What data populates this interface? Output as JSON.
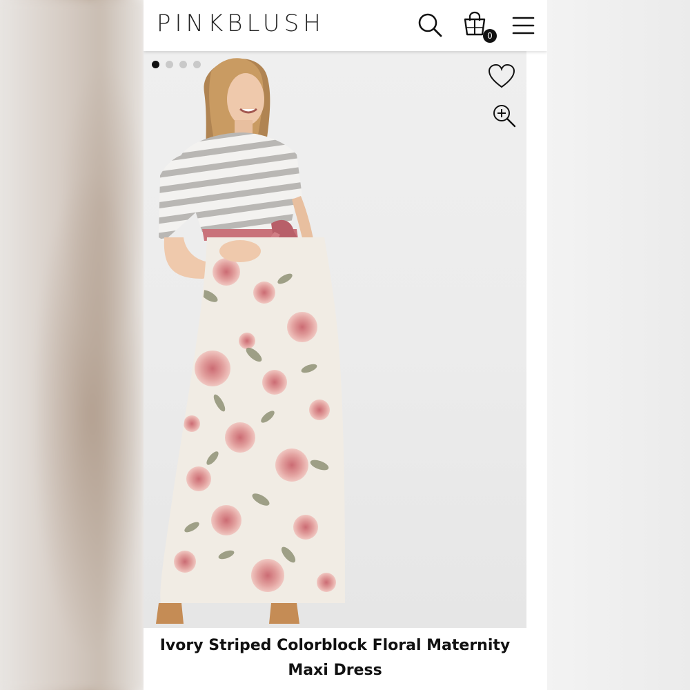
{
  "header": {
    "logo": "PINKBLUSH",
    "cart_count": "0",
    "icons": [
      "search-icon",
      "shopping-bag-icon",
      "hamburger-menu-icon"
    ]
  },
  "gallery": {
    "total_images": 4,
    "active_index": 0,
    "actions": [
      "heart-icon",
      "zoom-in-icon"
    ]
  },
  "product": {
    "title_line1": "Ivory Striped Colorblock Floral Maternity",
    "title_line2": "Maxi Dress"
  },
  "colors": {
    "stripe": "#b9b7b4",
    "sash": "#c9727a",
    "floral_pink": "#e19c9a",
    "leaf": "#8a8d6f",
    "skirt_base": "#f1ece4"
  }
}
